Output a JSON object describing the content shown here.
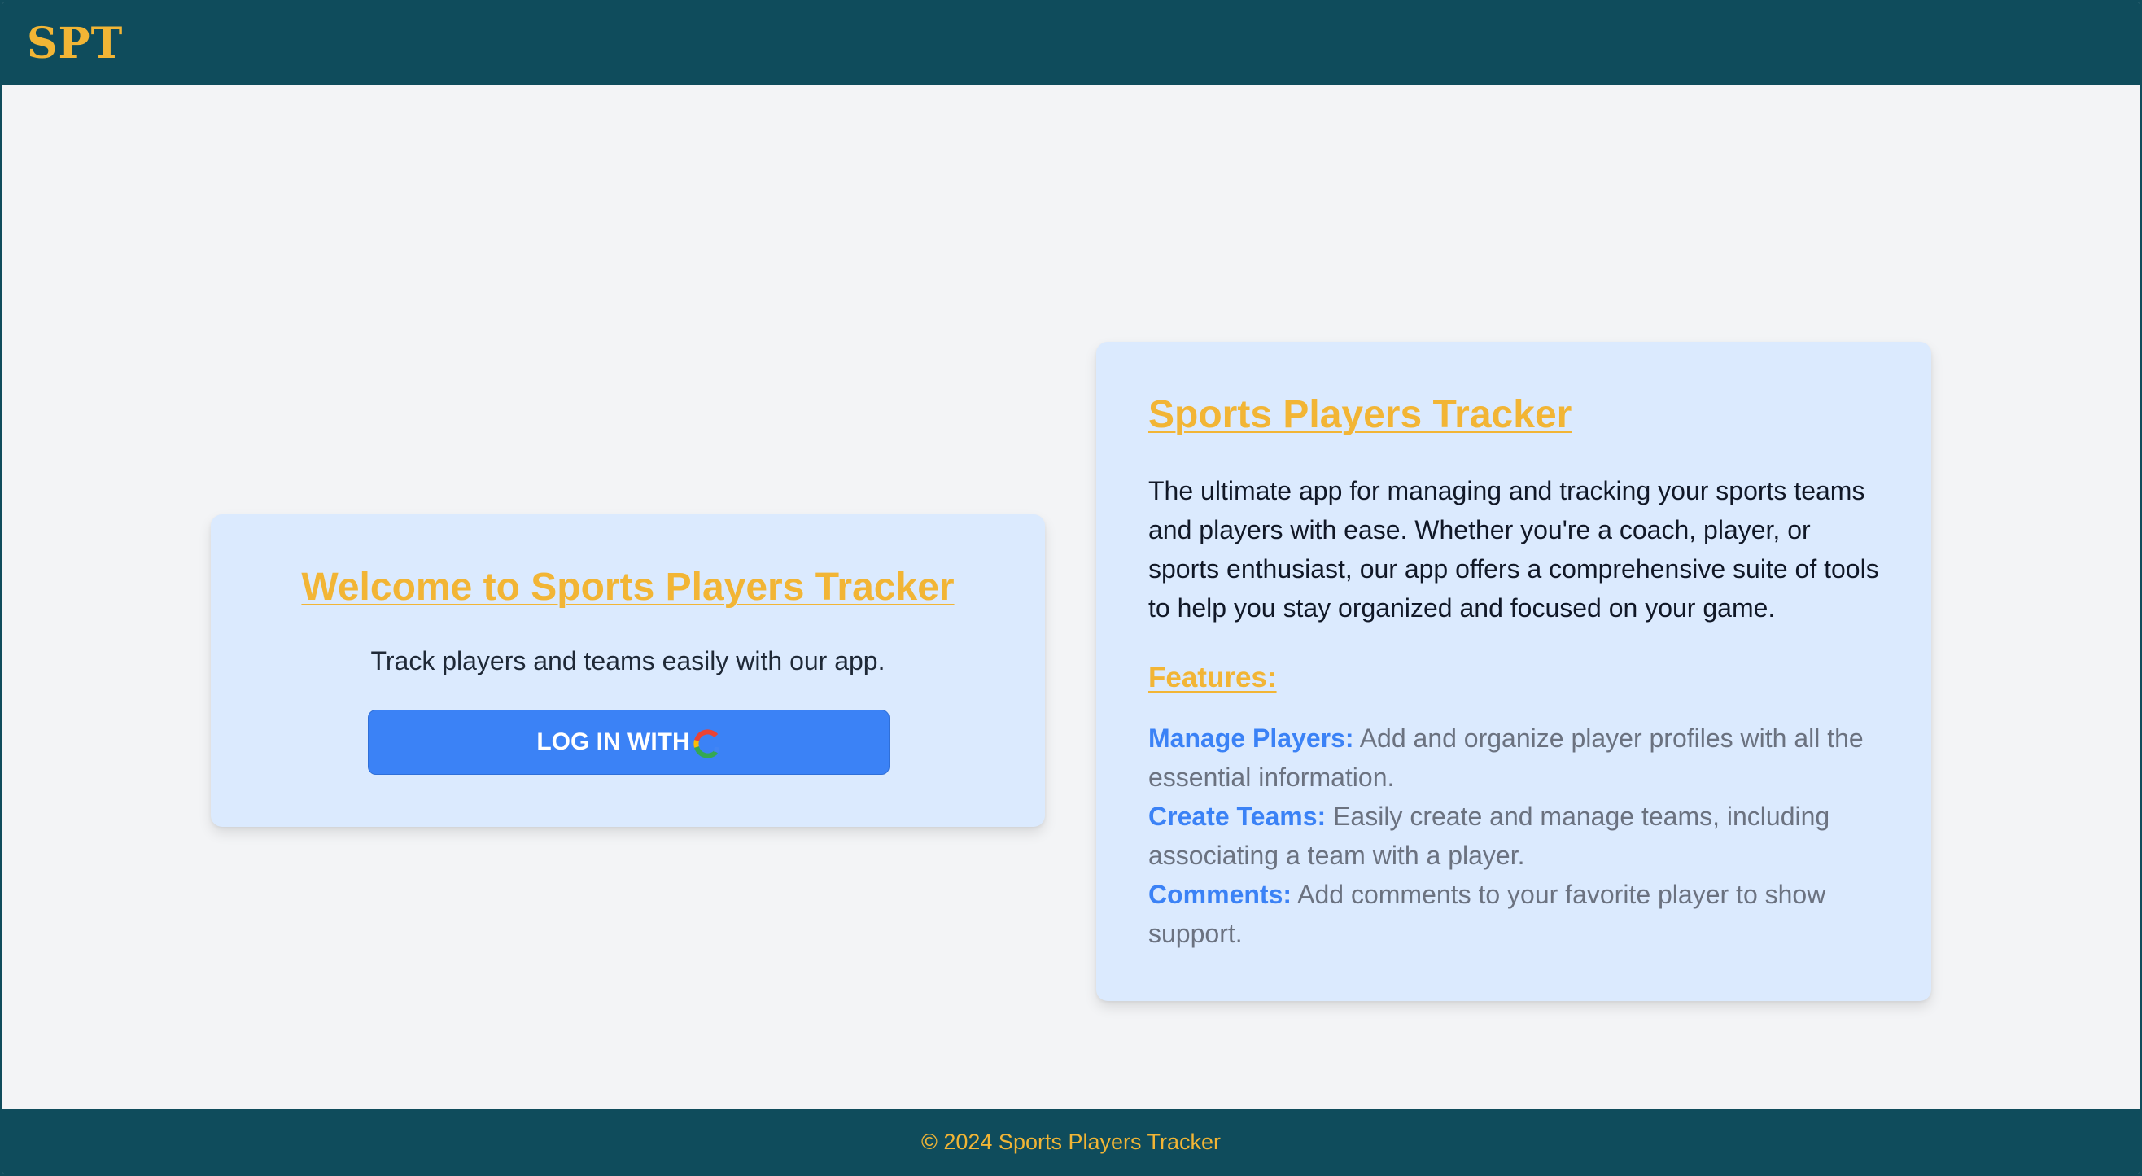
{
  "header": {
    "logo": "SPT"
  },
  "login_card": {
    "title": "Welcome to Sports Players Tracker",
    "subtitle": "Track players and teams easily with our app.",
    "button_label": "LOG IN WITH",
    "button_icon": "google-icon"
  },
  "about_card": {
    "title": "Sports Players Tracker",
    "description": "The ultimate app for managing and tracking your sports teams and players with ease. Whether you're a coach, player, or sports enthusiast, our app offers a comprehensive suite of tools to help you stay organized and focused on your game.",
    "features_title": "Features:",
    "features": [
      {
        "name": "Manage Players:",
        "text": " Add and organize player profiles with all the essential information."
      },
      {
        "name": "Create Teams:",
        "text": " Easily create and manage teams, including associating a team with a player."
      },
      {
        "name": "Comments:",
        "text": " Add comments to your favorite player to show support."
      }
    ]
  },
  "footer": {
    "copyright": "© 2024 Sports Players Tracker"
  },
  "colors": {
    "header_bg": "#0f4c5c",
    "accent_gold": "#f2b535",
    "card_bg": "#dbeafe",
    "button_blue": "#3b82f6",
    "page_bg": "#f3f4f6"
  }
}
